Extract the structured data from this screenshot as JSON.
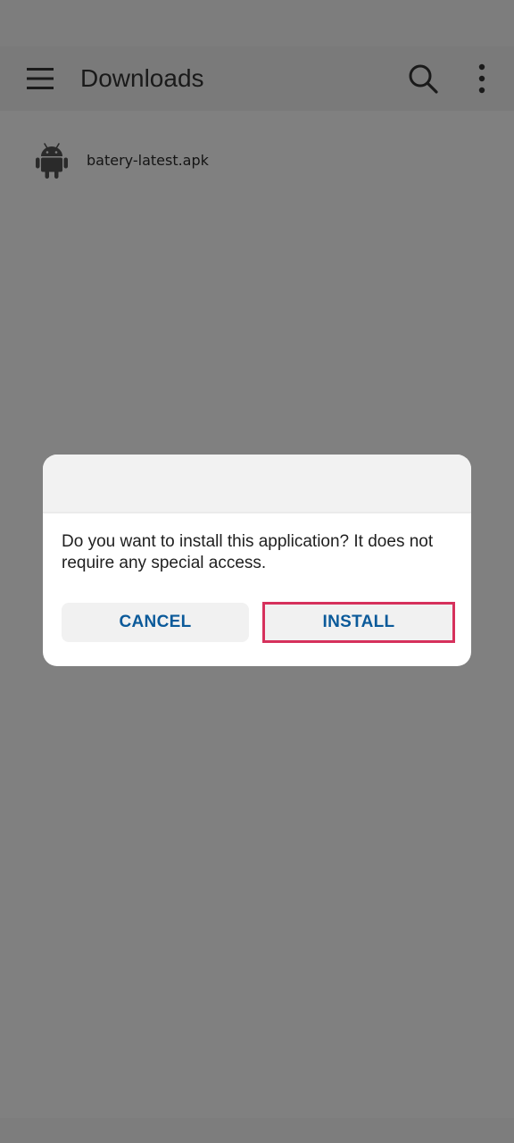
{
  "app_bar": {
    "title": "Downloads",
    "icons": [
      "menu-icon",
      "search-icon",
      "more-vertical-icon"
    ]
  },
  "files": [
    {
      "name": "batery-latest.apk",
      "icon": "android-icon"
    }
  ],
  "dialog": {
    "message": "Do you want to install this application? It does not require any special access.",
    "cancel_label": "CANCEL",
    "install_label": "INSTALL"
  },
  "colors": {
    "scrim": "#808080",
    "button_text": "#0b5a9a",
    "highlight": "#d6315c"
  }
}
